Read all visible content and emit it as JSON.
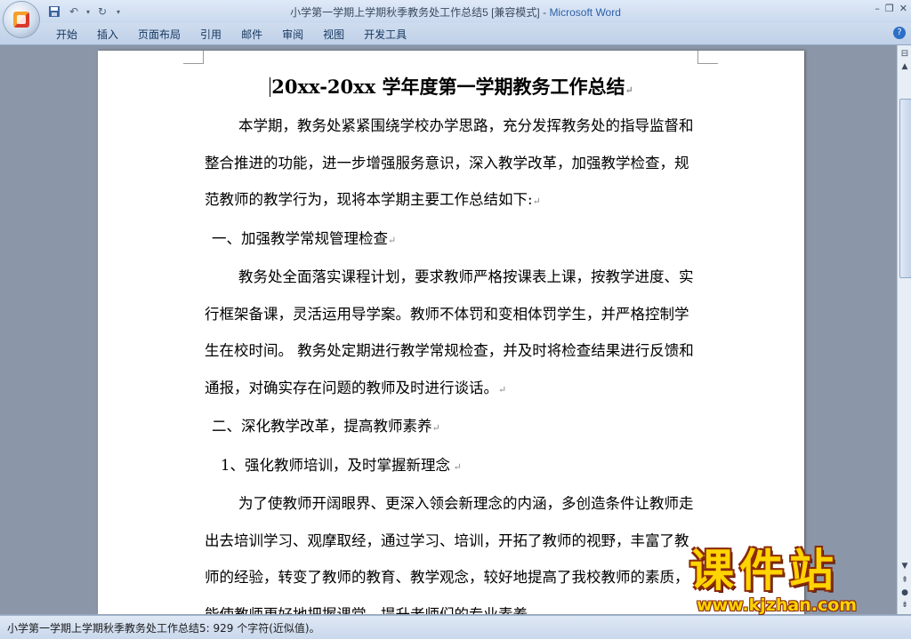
{
  "window": {
    "doc_title": "小学第一学期上学期秋季教务处工作总结5 [兼容模式]",
    "separator": " - ",
    "app_name": "Microsoft Word"
  },
  "qat": {
    "save_icon": "save-icon",
    "undo_icon": "undo-icon",
    "redo_icon": "redo-icon",
    "customize_icon": "customize-qat-icon"
  },
  "ribbon_tabs": [
    "开始",
    "插入",
    "页面布局",
    "引用",
    "邮件",
    "审阅",
    "视图",
    "开发工具"
  ],
  "document": {
    "title": "20xx-20xx 学年度第一学期教务工作总结",
    "paragraphs": [
      "本学期，教务处紧紧围绕学校办学思路，充分发挥教务处的指导监督和整合推进的功能，进一步增强服务意识，深入教学改革，加强教学检查，规范教师的教学行为，现将本学期主要工作总结如下:",
      "一、加强教学常规管理检查",
      "教务处全面落实课程计划，要求教师严格按课表上课，按教学进度、实行框架备课，灵活运用导学案。教师不体罚和变相体罚学生，并严格控制学生在校时间。 教务处定期进行教学常规检查，并及时将检查结果进行反馈和通报，对确实存在问题的教师及时进行谈话。",
      "二、深化教学改革，提高教师素养",
      "1、强化教师培训，及时掌握新理念",
      "为了使教师开阔眼界、更深入领会新理念的内涵，多创造条件让教师走出去培训学习、观摩取经，通过学习、培训，开拓了教师的视野，丰富了教师的经验，转变了教师的教育、教学观念，较好地提高了我校教师的素质，能使教师更好地把握课堂，提升老师们的专业素养"
    ]
  },
  "status": {
    "text": "小学第一学期上学期秋季教务处工作总结5: 929 个字符(近似值)。"
  },
  "watermark": {
    "big": "课件站",
    "url": "www.kjzhan.com"
  },
  "colors": {
    "app_name": "#2e5fa8",
    "watermark_fill": "#ffd400",
    "watermark_stroke": "#8a2a0a"
  }
}
